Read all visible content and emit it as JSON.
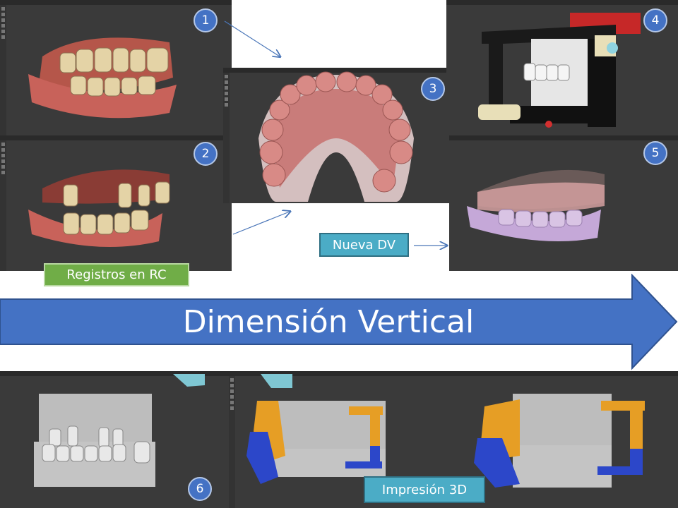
{
  "badges": {
    "b1": "1",
    "b2": "2",
    "b3": "3",
    "b4": "4",
    "b5": "5",
    "b6": "6"
  },
  "labels": {
    "registros": "Registros en RC",
    "nueva_dv": "Nueva DV",
    "impresion": "Impresión 3D"
  },
  "banner": {
    "title": "Dimensión Vertical"
  },
  "colors": {
    "badge": "#4472c4",
    "banner": "#4472c4",
    "registros_label": "#70ad47",
    "nueva_dv_label": "#4bacc6",
    "impresion_label": "#4bacc6",
    "viewport": "#3a3a3a"
  },
  "icons": [
    "arrow-icon",
    "tooth-icon"
  ]
}
